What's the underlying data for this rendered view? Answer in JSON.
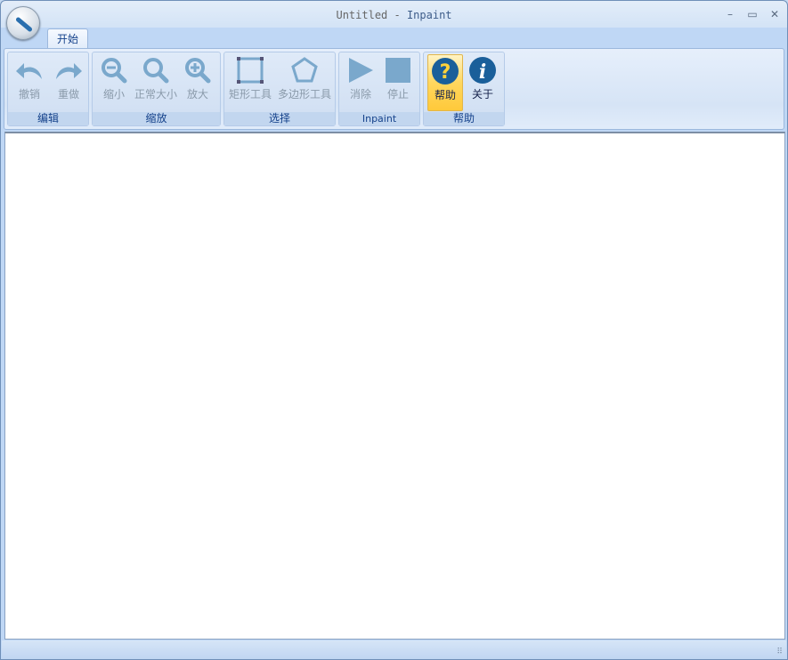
{
  "window": {
    "title_doc": "Untitled",
    "title_sep": " - ",
    "title_app": "Inpaint",
    "minimize": "–",
    "maximize": "▭",
    "close": "✕"
  },
  "tabs": [
    {
      "label": "开始"
    }
  ],
  "groups": [
    {
      "label": "编辑",
      "buttons": [
        {
          "label": "撤销",
          "icon": "undo-icon"
        },
        {
          "label": "重做",
          "icon": "redo-icon"
        }
      ]
    },
    {
      "label": "缩放",
      "buttons": [
        {
          "label": "缩小",
          "icon": "zoom-out-icon"
        },
        {
          "label": "正常大小",
          "icon": "zoom-normal-icon"
        },
        {
          "label": "放大",
          "icon": "zoom-in-icon"
        }
      ]
    },
    {
      "label": "选择",
      "buttons": [
        {
          "label": "矩形工具",
          "icon": "rectangle-icon"
        },
        {
          "label": "多边形工具",
          "icon": "polygon-icon"
        }
      ]
    },
    {
      "label": "Inpaint",
      "buttons": [
        {
          "label": "消除",
          "icon": "play-icon"
        },
        {
          "label": "停止",
          "icon": "stop-icon"
        }
      ]
    },
    {
      "label": "帮助",
      "buttons": [
        {
          "label": "帮助",
          "icon": "help-icon"
        },
        {
          "label": "关于",
          "icon": "info-icon"
        }
      ]
    }
  ]
}
